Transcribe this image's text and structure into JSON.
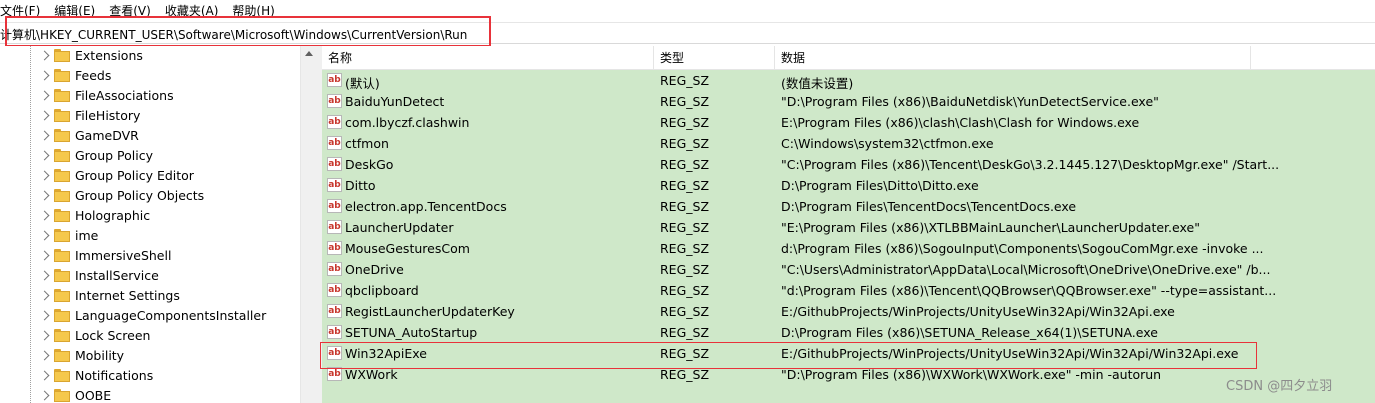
{
  "menubar": [
    "文件(F)",
    "编辑(E)",
    "查看(V)",
    "收藏夹(A)",
    "帮助(H)"
  ],
  "address": "计算机\\HKEY_CURRENT_USER\\Software\\Microsoft\\Windows\\CurrentVersion\\Run",
  "tree": {
    "items": [
      "Extensions",
      "Feeds",
      "FileAssociations",
      "FileHistory",
      "GameDVR",
      "Group Policy",
      "Group Policy Editor",
      "Group Policy Objects",
      "Holographic",
      "ime",
      "ImmersiveShell",
      "InstallService",
      "Internet Settings",
      "LanguageComponentsInstaller",
      "Lock Screen",
      "Mobility",
      "Notifications",
      "OOBE"
    ]
  },
  "list": {
    "headers": {
      "name": "名称",
      "type": "类型",
      "data": "数据"
    },
    "rows": [
      {
        "name": "(默认)",
        "type": "REG_SZ",
        "data": "(数值未设置)"
      },
      {
        "name": "BaiduYunDetect",
        "type": "REG_SZ",
        "data": "\"D:\\Program Files (x86)\\BaiduNetdisk\\YunDetectService.exe\""
      },
      {
        "name": "com.lbyczf.clashwin",
        "type": "REG_SZ",
        "data": "E:\\Program Files (x86)\\clash\\Clash\\Clash for Windows.exe"
      },
      {
        "name": "ctfmon",
        "type": "REG_SZ",
        "data": "C:\\Windows\\system32\\ctfmon.exe"
      },
      {
        "name": "DeskGo",
        "type": "REG_SZ",
        "data": "\"C:\\Program Files (x86)\\Tencent\\DeskGo\\3.2.1445.127\\DesktopMgr.exe\" /Start..."
      },
      {
        "name": "Ditto",
        "type": "REG_SZ",
        "data": "D:\\Program Files\\Ditto\\Ditto.exe"
      },
      {
        "name": "electron.app.TencentDocs",
        "type": "REG_SZ",
        "data": "D:\\Program Files\\TencentDocs\\TencentDocs.exe"
      },
      {
        "name": "LauncherUpdater",
        "type": "REG_SZ",
        "data": "\"E:\\Program Files (x86)\\XTLBBMainLauncher\\LauncherUpdater.exe\""
      },
      {
        "name": "MouseGesturesCom",
        "type": "REG_SZ",
        "data": "d:\\Program Files (x86)\\SogouInput\\Components\\SogouComMgr.exe -invoke ..."
      },
      {
        "name": "OneDrive",
        "type": "REG_SZ",
        "data": "\"C:\\Users\\Administrator\\AppData\\Local\\Microsoft\\OneDrive\\OneDrive.exe\" /b..."
      },
      {
        "name": "qbclipboard",
        "type": "REG_SZ",
        "data": "\"d:\\Program Files (x86)\\Tencent\\QQBrowser\\QQBrowser.exe\" --type=assistant..."
      },
      {
        "name": "RegistLauncherUpdaterKey",
        "type": "REG_SZ",
        "data": "E:/GithubProjects/WinProjects/UnityUseWin32Api/Win32Api.exe"
      },
      {
        "name": "SETUNA_AutoStartup",
        "type": "REG_SZ",
        "data": "D:\\Program Files (x86)\\SETUNA_Release_x64(1)\\SETUNA.exe"
      },
      {
        "name": "Win32ApiExe",
        "type": "REG_SZ",
        "data": "E:/GithubProjects/WinProjects/UnityUseWin32Api/Win32Api/Win32Api.exe"
      },
      {
        "name": "WXWork",
        "type": "REG_SZ",
        "data": "\"D:\\Program Files (x86)\\WXWork\\WXWork.exe\" -min -autorun"
      }
    ],
    "value_icon": "ab-string-icon",
    "selected_row_color": "#cfe8c9"
  },
  "watermark": "CSDN @四夕立羽",
  "colors": {
    "highlight_box": "#e8323a",
    "list_background": "#cfe8c9",
    "folder": "#f5c84c"
  }
}
